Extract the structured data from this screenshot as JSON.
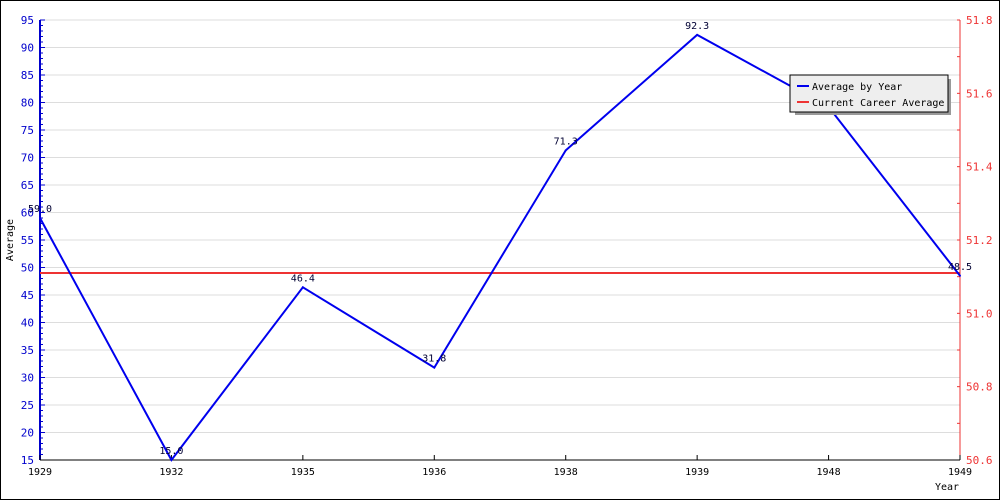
{
  "chart_data": {
    "type": "line",
    "title": "",
    "xlabel": "Year",
    "ylabel": "Average",
    "categories": [
      "1929",
      "1932",
      "1935",
      "1936",
      "1938",
      "1939",
      "1948",
      "1949"
    ],
    "series": [
      {
        "name": "Average by Year",
        "axis": "left",
        "color": "#0000ee",
        "values": [
          59.0,
          15.0,
          46.4,
          31.8,
          71.3,
          92.3,
          79.2,
          48.5
        ],
        "labels": [
          "59.0",
          "15.0",
          "46.4",
          "31.8",
          "71.3",
          "92.3",
          "",
          "48.5"
        ]
      },
      {
        "name": "Current Career Average",
        "axis": "right",
        "color": "#ee3333",
        "value": 51.11
      }
    ],
    "ylim": [
      15,
      95
    ],
    "yticks": [
      15,
      20,
      25,
      30,
      35,
      40,
      45,
      50,
      55,
      60,
      65,
      70,
      75,
      80,
      85,
      90,
      95
    ],
    "y2lim": [
      50.6,
      51.8
    ],
    "y2ticks": [
      "50.6",
      "50.8",
      "51.0",
      "51.2",
      "51.4",
      "51.6",
      "51.8"
    ],
    "grid": true,
    "legend_position": "top-right"
  },
  "colors": {
    "left_axis": "#0000cc",
    "right_axis": "#ee3333",
    "grid": "#dddddd"
  }
}
